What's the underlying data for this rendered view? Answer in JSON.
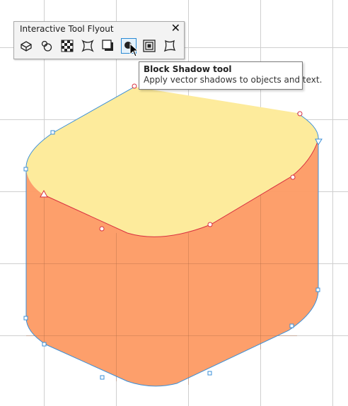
{
  "flyout": {
    "title": "Interactive Tool Flyout",
    "close_glyph": "✕",
    "tools": [
      {
        "icon": "blend-tool-icon",
        "active": false
      },
      {
        "icon": "contour-tool-icon",
        "active": false
      },
      {
        "icon": "transparency-tool-icon",
        "active": false
      },
      {
        "icon": "envelope-tool-icon",
        "active": false
      },
      {
        "icon": "drop-shadow-tool-icon",
        "active": false
      },
      {
        "icon": "block-shadow-tool-icon",
        "active": true
      },
      {
        "icon": "extrude-tool-icon",
        "active": false
      },
      {
        "icon": "distort-tool-icon",
        "active": false
      }
    ]
  },
  "tooltip": {
    "title": "Block Shadow tool",
    "description": "Apply vector shadows to objects and text."
  },
  "colors": {
    "top_face": "#fdeb9c",
    "side_face": "#fd9a63",
    "outline": "#3a8fd8",
    "control_outline": "#d83040",
    "grid": "#cfcfcf",
    "active_tool": "#2a8ad4"
  }
}
